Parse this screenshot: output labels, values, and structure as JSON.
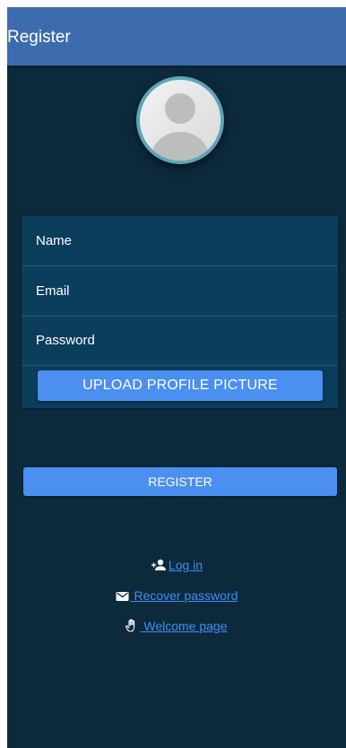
{
  "header": {
    "title": "Register"
  },
  "avatar": {
    "icon": "default-user-avatar"
  },
  "form": {
    "name_placeholder": "Name",
    "email_placeholder": "Email",
    "password_placeholder": "Password",
    "upload_label": "UPLOAD PROFILE PICTURE"
  },
  "register_label": "REGISTER",
  "links": {
    "login": {
      "icon": "person-add-icon",
      "label": "Log in"
    },
    "recover": {
      "icon": "envelope-icon",
      "label": " Recover password"
    },
    "welcome": {
      "icon": "hand-icon",
      "label": " Welcome page"
    }
  },
  "colors": {
    "background": "#0d2a3d",
    "header": "#3d6cae",
    "card": "#0b3d5c",
    "accent": "#4b8ff0",
    "link": "#3d8ff0"
  }
}
